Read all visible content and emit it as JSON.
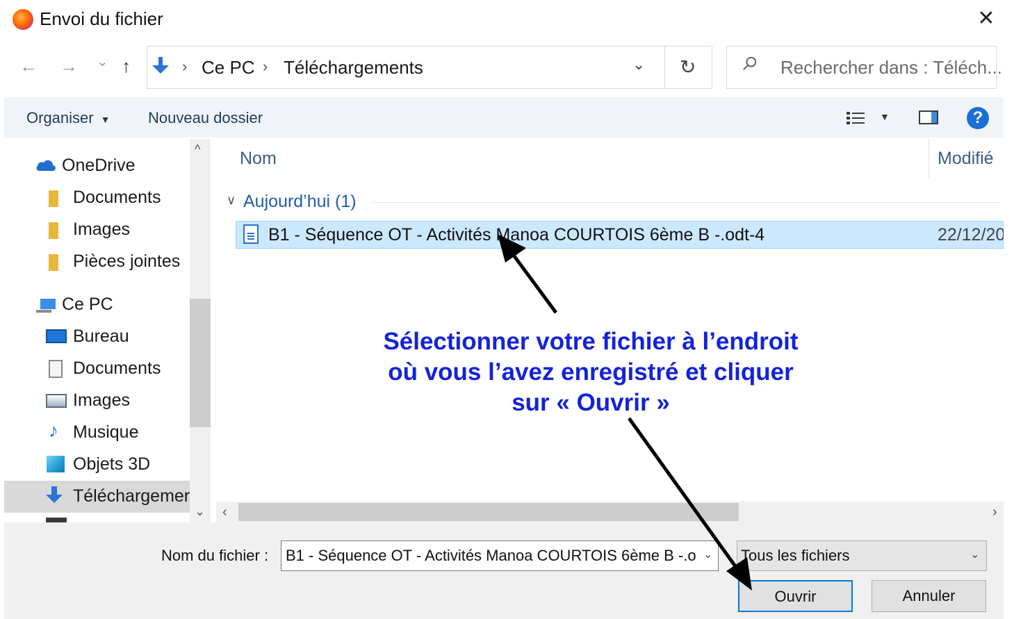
{
  "window": {
    "title": "Envoi du fichier",
    "close_glyph": "✕"
  },
  "nav": {
    "back": "←",
    "forward": "→",
    "recent": "⌄",
    "up": "↑",
    "breadcrumb": [
      "Ce PC",
      "Téléchargements"
    ],
    "separator": "›",
    "dropdown": "⌄",
    "refresh": "↻",
    "search_placeholder": "Rechercher dans : Téléch..."
  },
  "toolbar": {
    "organize": "Organiser",
    "new_folder": "Nouveau dossier",
    "help": "?"
  },
  "sidebar": {
    "items": [
      {
        "label": "OneDrive",
        "icon": "cloud-icon"
      },
      {
        "label": "Documents",
        "icon": "folder-icon"
      },
      {
        "label": "Images",
        "icon": "folder-icon"
      },
      {
        "label": "Pièces jointes",
        "icon": "folder-icon"
      },
      {
        "label": "Ce PC",
        "icon": "computer-icon"
      },
      {
        "label": "Bureau",
        "icon": "desktop-icon"
      },
      {
        "label": "Documents",
        "icon": "document-icon"
      },
      {
        "label": "Images",
        "icon": "picture-icon"
      },
      {
        "label": "Musique",
        "icon": "music-icon"
      },
      {
        "label": "Objets 3D",
        "icon": "cube-icon"
      },
      {
        "label": "Téléchargemer",
        "icon": "download-icon",
        "selected": true
      }
    ]
  },
  "file_list": {
    "columns": [
      "Nom",
      "Modifié"
    ],
    "group": "Aujourd’hui (1)",
    "files": [
      {
        "name": "B1 - Séquence OT - Activités Manoa COURTOIS 6ème B -.odt-4",
        "modified": "22/12/20"
      }
    ]
  },
  "footer": {
    "filename_label": "Nom du fichier :",
    "filename_value": "B1 - Séquence OT - Activités Manoa COURTOIS 6ème B -.o",
    "filetype": "Tous les fichiers",
    "open": "Ouvrir",
    "cancel": "Annuler"
  },
  "annotation": {
    "lines": [
      "Sélectionner votre fichier à l’endroit",
      " où vous l’avez enregistré et cliquer",
      "sur « Ouvrir »"
    ],
    "color": "#1423d8"
  },
  "colors": {
    "accent": "#0078d7",
    "selection": "#cce8ff",
    "link": "#1f5fa8"
  }
}
